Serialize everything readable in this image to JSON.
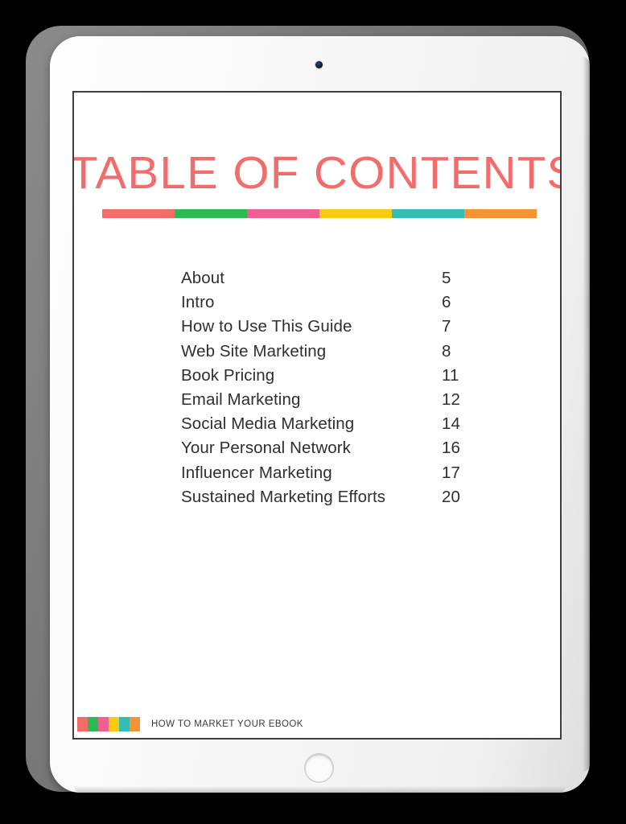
{
  "device": {
    "name": "tablet",
    "camera_label": "front-camera",
    "home_button_label": "home-button",
    "shell_color": "#7e7e7e",
    "body_color": "#f7f7f7"
  },
  "document": {
    "title": "TABLE OF CONTENTS",
    "title_color": "#f26c6c",
    "page_background": "#ffffff",
    "border_color": "#3e3e3e"
  },
  "palette": {
    "colors": [
      {
        "name": "coral",
        "hex": "#f26c6c"
      },
      {
        "name": "green",
        "hex": "#2eb853"
      },
      {
        "name": "pink",
        "hex": "#ef5f92"
      },
      {
        "name": "yellow",
        "hex": "#f5cb14"
      },
      {
        "name": "teal",
        "hex": "#35bdb4"
      },
      {
        "name": "orange",
        "hex": "#f59336"
      }
    ]
  },
  "toc": {
    "entries": [
      {
        "title": "About",
        "page": "5"
      },
      {
        "title": "Intro",
        "page": "6"
      },
      {
        "title": "How to Use This Guide",
        "page": "7"
      },
      {
        "title": "Web Site Marketing",
        "page": "8"
      },
      {
        "title": "Book Pricing",
        "page": "11"
      },
      {
        "title": "Email Marketing",
        "page": "12"
      },
      {
        "title": "Social Media Marketing",
        "page": "14"
      },
      {
        "title": "Your Personal Network",
        "page": "16"
      },
      {
        "title": "Influencer Marketing",
        "page": "17"
      },
      {
        "title": "Sustained Marketing Efforts",
        "page": "20"
      }
    ]
  },
  "footer": {
    "label": "HOW TO MARKET YOUR EBOOK"
  }
}
